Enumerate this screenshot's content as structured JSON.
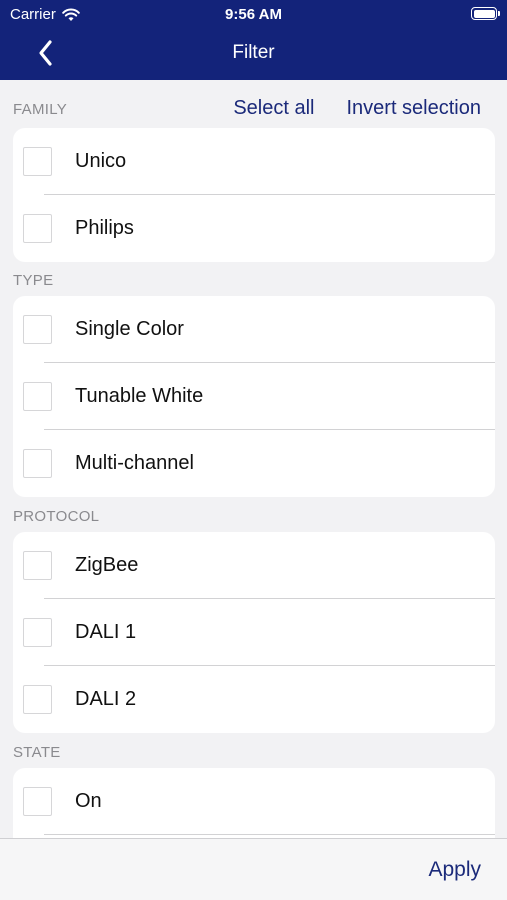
{
  "status_bar": {
    "carrier": "Carrier",
    "time": "9:56 AM"
  },
  "nav": {
    "title": "Filter",
    "back_icon": "chevron-left-icon"
  },
  "actions": {
    "select_all": "Select all",
    "invert_selection": "Invert selection"
  },
  "sections": {
    "family": {
      "header": "FAMILY",
      "items": [
        "Unico",
        "Philips"
      ]
    },
    "type": {
      "header": "TYPE",
      "items": [
        "Single Color",
        "Tunable White",
        "Multi-channel"
      ]
    },
    "protocol": {
      "header": "PROTOCOL",
      "items": [
        "ZigBee",
        "DALI 1",
        "DALI 2"
      ]
    },
    "state": {
      "header": "STATE",
      "items": [
        "On"
      ]
    }
  },
  "footer": {
    "apply": "Apply"
  },
  "colors": {
    "nav_bar": "#13237a",
    "accent": "#1b2a7a",
    "background": "#f2f2f4"
  }
}
